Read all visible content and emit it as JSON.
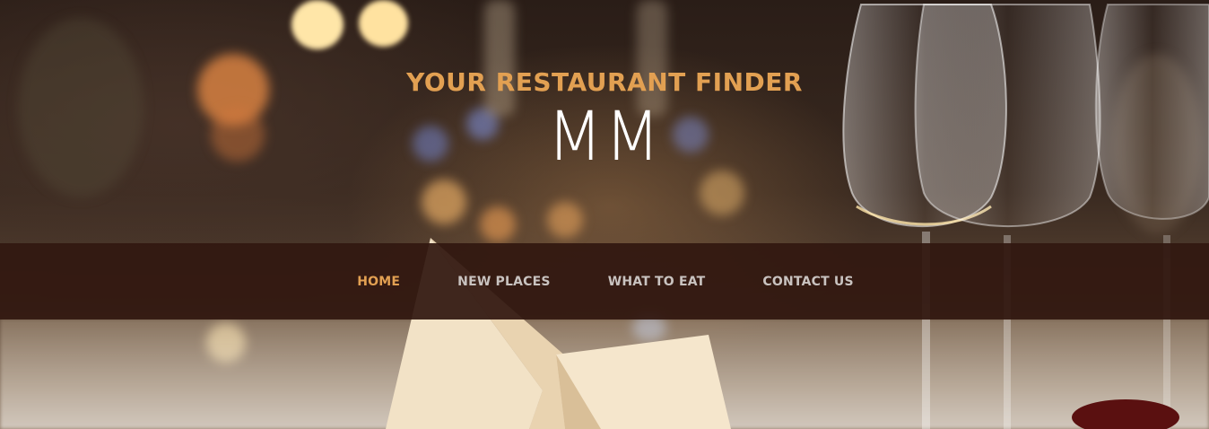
{
  "header": {
    "title": "YOUR RESTAURANT FINDER",
    "logo_text": "MM"
  },
  "nav": {
    "items": [
      {
        "label": "HOME",
        "active": true
      },
      {
        "label": "NEW PLACES",
        "active": false
      },
      {
        "label": "WHAT TO EAT",
        "active": false
      },
      {
        "label": "CONTACT US",
        "active": false
      }
    ]
  },
  "colors": {
    "accent": "#e2a052",
    "nav_background": "#321810",
    "nav_text": "#c9c3c0",
    "logo_text": "#ffffff"
  }
}
